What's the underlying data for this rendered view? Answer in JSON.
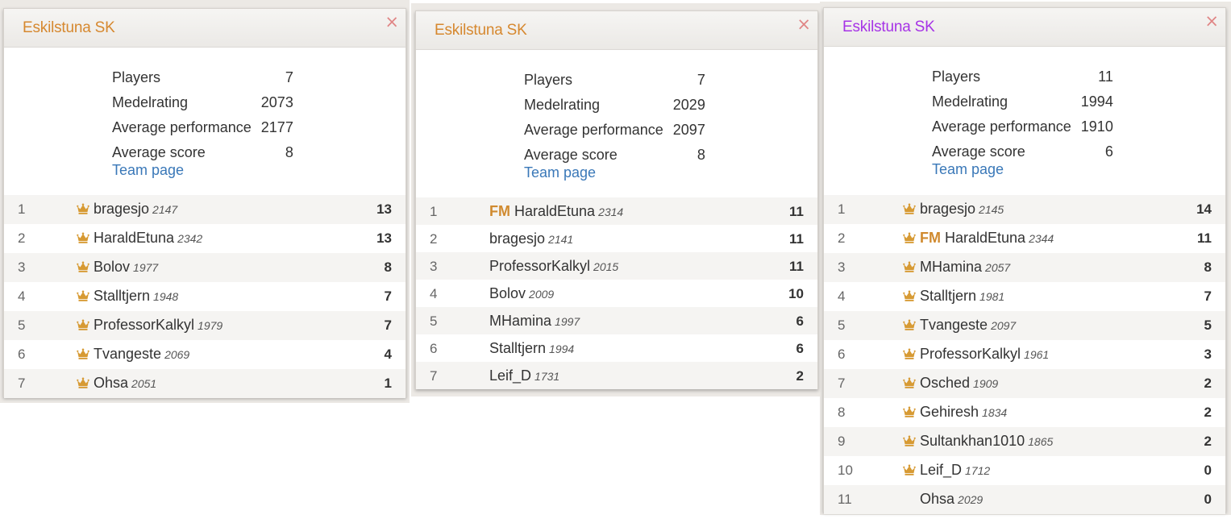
{
  "colors": {
    "title_orange": "#d6882f",
    "title_purple": "#a633e6",
    "link_blue": "#3a78b8",
    "patron_gold": "#d79a33",
    "fm_orange": "#d08a2f",
    "close_pink": "#e08585"
  },
  "panels": [
    {
      "title": "Eskilstuna SK",
      "title_color": "#d6882f",
      "close_icon": "×",
      "stats": [
        {
          "label": "Players",
          "value": "7"
        },
        {
          "label": "Medelrating",
          "value": "2073"
        },
        {
          "label": "Average performance",
          "value": "2177"
        },
        {
          "label": "Average score",
          "value": "8"
        }
      ],
      "team_link": "Team page",
      "rows": [
        {
          "rank": "1",
          "patron": true,
          "title": "",
          "name": "bragesjo",
          "rating": "2147",
          "score": "13"
        },
        {
          "rank": "2",
          "patron": true,
          "title": "",
          "name": "HaraldEtuna",
          "rating": "2342",
          "score": "13"
        },
        {
          "rank": "3",
          "patron": true,
          "title": "",
          "name": "Bolov",
          "rating": "1977",
          "score": "8"
        },
        {
          "rank": "4",
          "patron": true,
          "title": "",
          "name": "Stalltjern",
          "rating": "1948",
          "score": "7"
        },
        {
          "rank": "5",
          "patron": true,
          "title": "",
          "name": "ProfessorKalkyl",
          "rating": "1979",
          "score": "7"
        },
        {
          "rank": "6",
          "patron": true,
          "title": "",
          "name": "Tvangeste",
          "rating": "2069",
          "score": "4"
        },
        {
          "rank": "7",
          "patron": true,
          "title": "",
          "name": "Ohsa",
          "rating": "2051",
          "score": "1"
        }
      ]
    },
    {
      "title": "Eskilstuna SK",
      "title_color": "#d6882f",
      "close_icon": "×",
      "stats": [
        {
          "label": "Players",
          "value": "7"
        },
        {
          "label": "Medelrating",
          "value": "2029"
        },
        {
          "label": "Average performance",
          "value": "2097"
        },
        {
          "label": "Average score",
          "value": "8"
        }
      ],
      "team_link": "Team page",
      "rows": [
        {
          "rank": "1",
          "patron": false,
          "title": "FM",
          "name": "HaraldEtuna",
          "rating": "2314",
          "score": "11"
        },
        {
          "rank": "2",
          "patron": false,
          "title": "",
          "name": "bragesjo",
          "rating": "2141",
          "score": "11"
        },
        {
          "rank": "3",
          "patron": false,
          "title": "",
          "name": "ProfessorKalkyl",
          "rating": "2015",
          "score": "11"
        },
        {
          "rank": "4",
          "patron": false,
          "title": "",
          "name": "Bolov",
          "rating": "2009",
          "score": "10"
        },
        {
          "rank": "5",
          "patron": false,
          "title": "",
          "name": "MHamina",
          "rating": "1997",
          "score": "6"
        },
        {
          "rank": "6",
          "patron": false,
          "title": "",
          "name": "Stalltjern",
          "rating": "1994",
          "score": "6"
        },
        {
          "rank": "7",
          "patron": false,
          "title": "",
          "name": "Leif_D",
          "rating": "1731",
          "score": "2"
        }
      ]
    },
    {
      "title": "Eskilstuna SK",
      "title_color": "#a633e6",
      "close_icon": "×",
      "stats": [
        {
          "label": "Players",
          "value": "11"
        },
        {
          "label": "Medelrating",
          "value": "1994"
        },
        {
          "label": "Average performance",
          "value": "1910"
        },
        {
          "label": "Average score",
          "value": "6"
        }
      ],
      "team_link": "Team page",
      "rows": [
        {
          "rank": "1",
          "patron": true,
          "title": "",
          "name": "bragesjo",
          "rating": "2145",
          "score": "14"
        },
        {
          "rank": "2",
          "patron": true,
          "title": "FM",
          "name": "HaraldEtuna",
          "rating": "2344",
          "score": "11"
        },
        {
          "rank": "3",
          "patron": true,
          "title": "",
          "name": "MHamina",
          "rating": "2057",
          "score": "8"
        },
        {
          "rank": "4",
          "patron": true,
          "title": "",
          "name": "Stalltjern",
          "rating": "1981",
          "score": "7"
        },
        {
          "rank": "5",
          "patron": true,
          "title": "",
          "name": "Tvangeste",
          "rating": "2097",
          "score": "5"
        },
        {
          "rank": "6",
          "patron": true,
          "title": "",
          "name": "ProfessorKalkyl",
          "rating": "1961",
          "score": "3"
        },
        {
          "rank": "7",
          "patron": true,
          "title": "",
          "name": "Osched",
          "rating": "1909",
          "score": "2"
        },
        {
          "rank": "8",
          "patron": true,
          "title": "",
          "name": "Gehiresh",
          "rating": "1834",
          "score": "2"
        },
        {
          "rank": "9",
          "patron": true,
          "title": "",
          "name": "Sultankhan1010",
          "rating": "1865",
          "score": "2"
        },
        {
          "rank": "10",
          "patron": true,
          "title": "",
          "name": "Leif_D",
          "rating": "1712",
          "score": "0"
        },
        {
          "rank": "11",
          "patron": false,
          "title": "",
          "name": "Ohsa",
          "rating": "2029",
          "score": "0"
        }
      ]
    }
  ]
}
